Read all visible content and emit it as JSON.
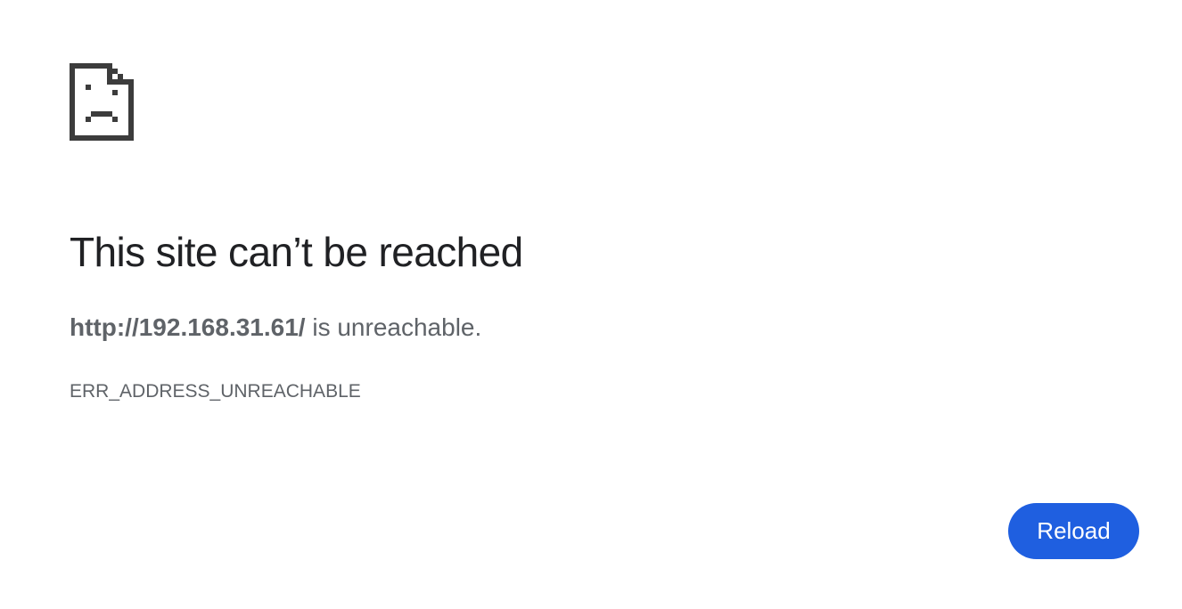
{
  "error": {
    "icon": "sad-page-icon",
    "headline": "This site can’t be reached",
    "url": "http://192.168.31.61/",
    "summary_suffix": " is unreachable.",
    "code": "ERR_ADDRESS_UNREACHABLE"
  },
  "actions": {
    "reload_label": "Reload"
  },
  "colors": {
    "button": "#1f5fe0",
    "headline": "#202124",
    "body_text": "#5f6368",
    "icon": "#3c3c3c"
  }
}
